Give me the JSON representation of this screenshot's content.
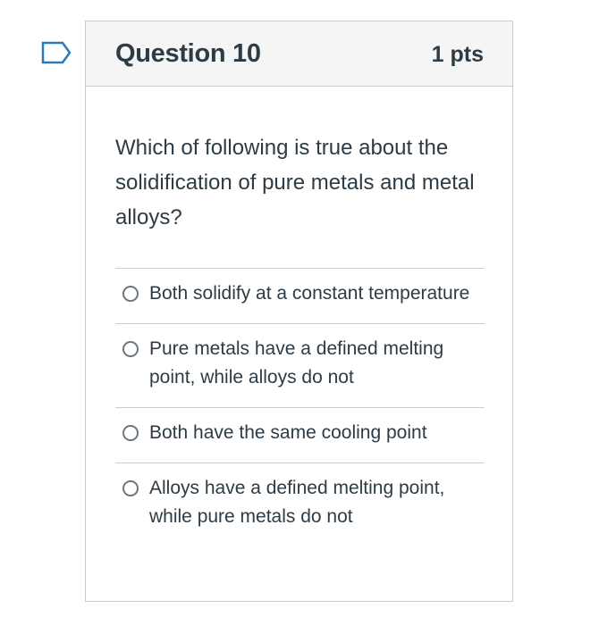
{
  "question": {
    "title": "Question 10",
    "points": "1 pts",
    "flag_icon": "flag-outline-icon",
    "text": "Which of following is true about the solidification of pure metals and metal alloys?"
  },
  "answers": [
    {
      "label": "Both solidify at a constant temperature",
      "selected": false
    },
    {
      "label": "Pure metals have a defined melting point, while alloys do not",
      "selected": false
    },
    {
      "label": "Both have the same cooling point",
      "selected": false
    },
    {
      "label": "Alloys have a defined melting point, while pure metals do not",
      "selected": false
    }
  ],
  "colors": {
    "text": "#2d3b45",
    "border": "#c7cdd1",
    "header_bg": "#f5f5f5",
    "flag": "#2b7abc"
  }
}
